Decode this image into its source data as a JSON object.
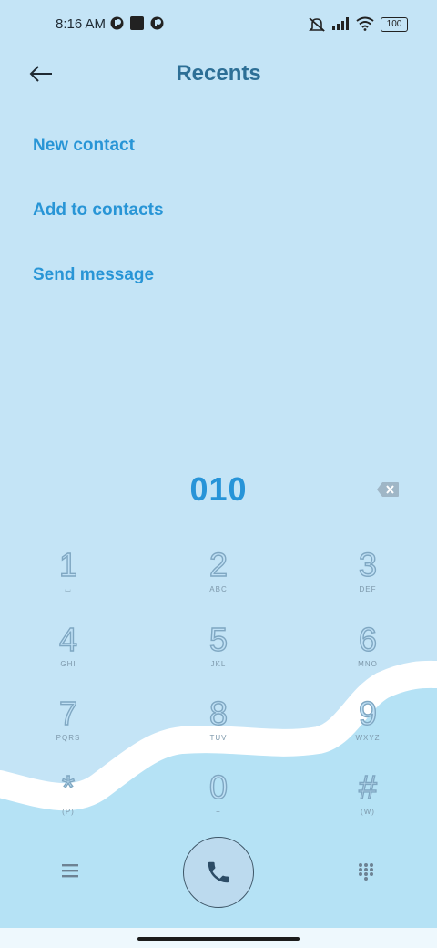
{
  "status_bar": {
    "time": "8:16 AM",
    "battery": "100",
    "icons": [
      "app-notification-icon",
      "square-notification-icon",
      "app-notification-icon",
      "mute-icon",
      "signal-icon",
      "wifi-icon",
      "battery-icon"
    ]
  },
  "header": {
    "title": "Recents"
  },
  "actions": [
    {
      "label": "New contact"
    },
    {
      "label": "Add to contacts"
    },
    {
      "label": "Send message"
    }
  ],
  "dialer": {
    "number": "010",
    "keys": [
      {
        "digit": "1",
        "letters": "⌴"
      },
      {
        "digit": "2",
        "letters": "ABC"
      },
      {
        "digit": "3",
        "letters": "DEF"
      },
      {
        "digit": "4",
        "letters": "GHI"
      },
      {
        "digit": "5",
        "letters": "JKL"
      },
      {
        "digit": "6",
        "letters": "MNO"
      },
      {
        "digit": "7",
        "letters": "PQRS"
      },
      {
        "digit": "8",
        "letters": "TUV"
      },
      {
        "digit": "9",
        "letters": "WXYZ"
      },
      {
        "digit": "*",
        "letters": "(P)"
      },
      {
        "digit": "0",
        "letters": "+"
      },
      {
        "digit": "#",
        "letters": "(W)"
      }
    ]
  },
  "colors": {
    "background": "#c4e4f6",
    "accent": "#2895d6",
    "title": "#2d6f96",
    "wave": "#ffffff",
    "lower_background": "#b5e2f5"
  }
}
